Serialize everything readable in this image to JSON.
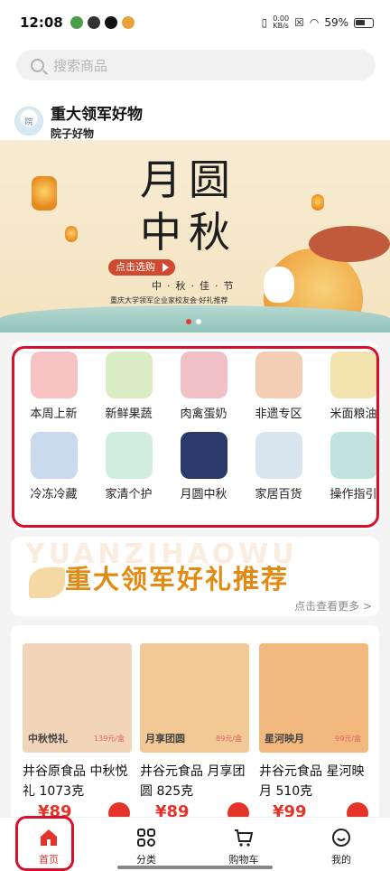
{
  "status_bar": {
    "time": "12:08",
    "net_speed_value": "0.00",
    "net_speed_unit": "KB/s",
    "battery": "59%"
  },
  "search": {
    "placeholder": "搜索商品"
  },
  "store": {
    "name": "重大领军好物",
    "subtitle": "院子好物"
  },
  "banner": {
    "title": "月圆中秋",
    "cta": "点击选购",
    "subtitle": "中·秋·佳·节",
    "caption": "重庆大学领军企业家校友会·好礼推荐",
    "active_slide": 1,
    "slide_count": 2
  },
  "categories": [
    {
      "label": "本周上新",
      "icon": "new-arrivals-icon",
      "color": "#f7c2c2"
    },
    {
      "label": "新鲜果蔬",
      "icon": "vegetables-icon",
      "color": "#d9ecc3"
    },
    {
      "label": "肉禽蛋奶",
      "icon": "meat-icon",
      "color": "#f1c0c6"
    },
    {
      "label": "非遗专区",
      "icon": "heritage-food-icon",
      "color": "#f4cdb5"
    },
    {
      "label": "米面粮油",
      "icon": "grain-oil-icon",
      "color": "#f2e2ae"
    },
    {
      "label": "冷冻冷藏",
      "icon": "frozen-shrimp-icon",
      "color": "#c9d9ee"
    },
    {
      "label": "家清个护",
      "icon": "household-care-icon",
      "color": "#cfeee0"
    },
    {
      "label": "月圆中秋",
      "icon": "mid-autumn-icon",
      "color": "#2c3a6b"
    },
    {
      "label": "家居百货",
      "icon": "home-goods-icon",
      "color": "#d8e4ee"
    },
    {
      "label": "操作指引",
      "icon": "guide-book-icon",
      "color": "#bfe3dc"
    }
  ],
  "promo": {
    "background_text": "YUANZIHAOWU",
    "title": "重大领军好礼推荐",
    "more_link": "点击查看更多 >"
  },
  "products": [
    {
      "image_tag": "中秋悦礼",
      "image_price": "139元/盒",
      "title": "井谷原食品 中秋悦礼 1073克",
      "price": "¥89",
      "bg": "#f2d4b8"
    },
    {
      "image_tag": "月享团圆",
      "image_price": "89元/盒",
      "title": "井谷元食品 月享团圆 825克",
      "price": "¥89",
      "bg": "#f2c894"
    },
    {
      "image_tag": "星河映月",
      "image_price": "99元/盒",
      "title": "井谷元食品 星河映月 510克",
      "price": "¥99",
      "bg": "#f3b87e"
    }
  ],
  "tabbar": [
    {
      "label": "首页",
      "icon": "home-icon",
      "active": true
    },
    {
      "label": "分类",
      "icon": "category-grid-icon",
      "active": false
    },
    {
      "label": "购物车",
      "icon": "cart-icon",
      "active": false
    },
    {
      "label": "我的",
      "icon": "profile-icon",
      "active": false
    }
  ],
  "colors": {
    "accent": "#e4342a",
    "annotation": "#d9102a",
    "promo_gold": "#e38a12"
  }
}
